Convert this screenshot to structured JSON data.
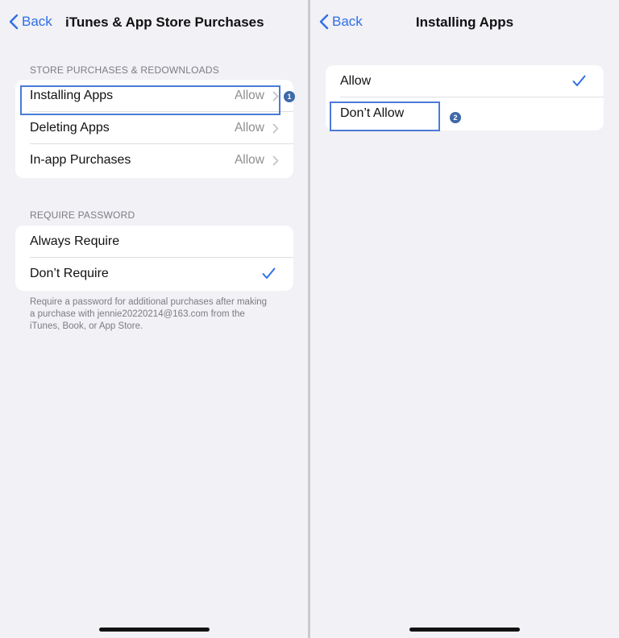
{
  "left": {
    "back_label": "Back",
    "title": "iTunes & App Store Purchases",
    "store_section": {
      "header": "STORE PURCHASES & REDOWNLOADS",
      "rows": [
        {
          "label": "Installing Apps",
          "value": "Allow"
        },
        {
          "label": "Deleting Apps",
          "value": "Allow"
        },
        {
          "label": "In-app Purchases",
          "value": "Allow"
        }
      ]
    },
    "password_section": {
      "header": "REQUIRE PASSWORD",
      "rows": [
        {
          "label": "Always Require",
          "checked": false
        },
        {
          "label": "Don’t Require",
          "checked": true
        }
      ],
      "footer": "Require a password for additional purchases after making a purchase with jennie20220214@163.com from the iTunes, Book, or App Store."
    },
    "step_badge": "1"
  },
  "right": {
    "back_label": "Back",
    "title": "Installing Apps",
    "options": [
      {
        "label": "Allow",
        "checked": true
      },
      {
        "label": "Don’t Allow",
        "checked": false
      }
    ],
    "step_badge": "2"
  },
  "colors": {
    "accent": "#2f6fe6",
    "highlight": "#4a7bd8",
    "badge": "#3f69a8",
    "background": "#f1f1f6"
  }
}
